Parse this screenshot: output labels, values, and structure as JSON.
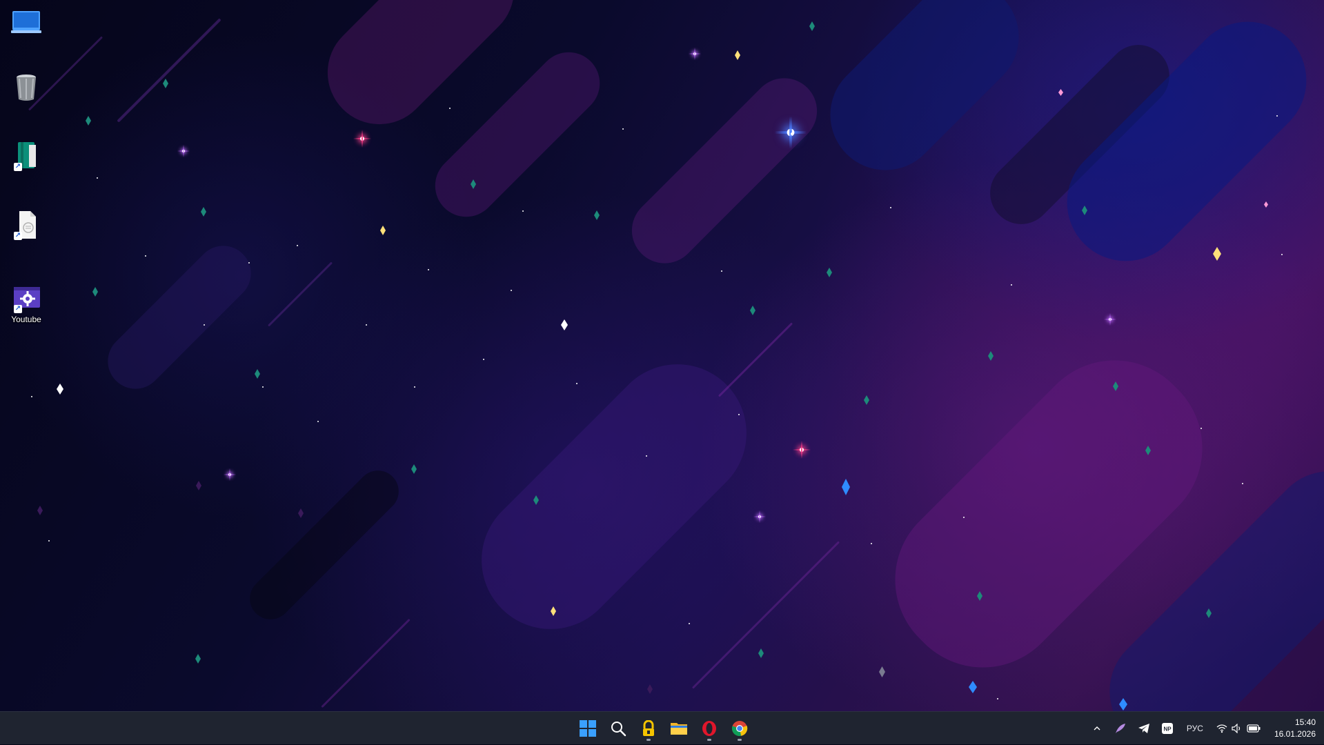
{
  "desktop": {
    "icons": [
      {
        "name": "this-pc-icon",
        "label": "",
        "shortcut": false
      },
      {
        "name": "recycle-bin-icon",
        "label": "",
        "shortcut": false
      },
      {
        "name": "notebook-app-icon",
        "label": "",
        "shortcut": true
      },
      {
        "name": "document-icon",
        "label": "",
        "shortcut": true
      },
      {
        "name": "youtube-settings-icon",
        "label": "Youtube",
        "shortcut": true
      }
    ]
  },
  "taskbar": {
    "pinned": [
      {
        "name": "start-button",
        "icon": "windows-logo-icon",
        "running": false
      },
      {
        "name": "search-button",
        "icon": "search-icon",
        "running": false
      },
      {
        "name": "vpn-app-button",
        "icon": "lock-app-icon",
        "running": true
      },
      {
        "name": "file-explorer-button",
        "icon": "folder-icon",
        "running": false
      },
      {
        "name": "opera-button",
        "icon": "opera-icon",
        "running": true
      },
      {
        "name": "chrome-button",
        "icon": "chrome-icon",
        "running": true
      }
    ],
    "tray": {
      "language": "РУС",
      "time": "15:40",
      "date": "16.01.2026"
    }
  },
  "colors": {
    "taskbar_bg": "#1f2430",
    "accent": "#3aa0ff",
    "opera_red": "#e0162b"
  }
}
